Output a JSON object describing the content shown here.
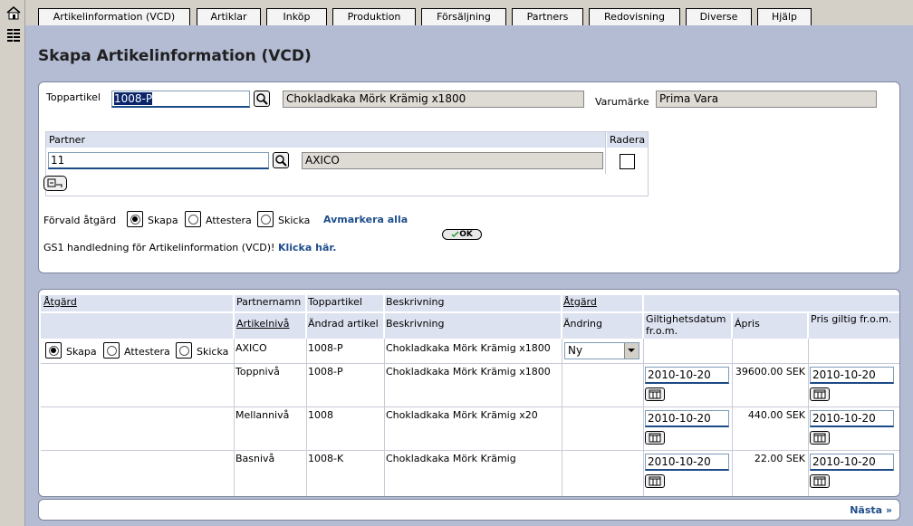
{
  "nav_tabs": [
    {
      "label": "Artikelinformation (VCD)"
    },
    {
      "label": "Artiklar"
    },
    {
      "label": "Inköp"
    },
    {
      "label": "Produktion"
    },
    {
      "label": "Försäljning"
    },
    {
      "label": "Partners"
    },
    {
      "label": "Redovisning"
    },
    {
      "label": "Diverse"
    },
    {
      "label": "Hjälp"
    }
  ],
  "page_title": "Skapa Artikelinformation (VCD)",
  "form": {
    "toppartikel_label": "Toppartikel",
    "toppartikel_value": "1008-P",
    "toppartikel_desc": "Chokladkaka Mörk Krämig x1800",
    "varumarke_label": "Varumärke",
    "varumarke_value": "Prima Vara",
    "partner_label": "Partner",
    "radera_label": "Radera",
    "partner_value": "11",
    "partner_name": "AXICO",
    "forvald_label": "Förvald åtgärd",
    "action_skapa": "Skapa",
    "action_attestera": "Attestera",
    "action_skicka": "Skicka",
    "avmarkera_label": "Avmarkera alla",
    "ok_label": "OK",
    "gs1_text": "GS1 handledning för Artikelinformation (VCD)!",
    "gs1_link": "Klicka här."
  },
  "table": {
    "h1": {
      "atgard": "Åtgärd",
      "partnernamn": "Partnernamn",
      "toppartikel": "Toppartikel",
      "beskrivning": "Beskrivning",
      "atgard2": "Åtgärd"
    },
    "h2": {
      "artikelniva": "Artikelnivå",
      "andrad_artikel": "Ändrad artikel",
      "beskrivning": "Beskrivning",
      "andring": "Ändring",
      "giltighet": "Giltighetsdatum fr.o.m.",
      "apris": "Ápris",
      "pris_giltig": "Pris giltig fr.o.m."
    },
    "partner_row": {
      "skapa": "Skapa",
      "attestera": "Attestera",
      "skicka": "Skicka",
      "partnernamn": "AXICO",
      "toppartikel": "1008-P",
      "beskrivning": "Chokladkaka Mörk Krämig x1800",
      "andring": "Ny"
    },
    "rows": [
      {
        "niva": "Toppnivå",
        "artikel": "1008-P",
        "beskrivning": "Chokladkaka Mörk Krämig x1800",
        "giltighet": "2010-10-20",
        "apris": "39600.00 SEK",
        "pris_giltig": "2010-10-20"
      },
      {
        "niva": "Mellannivå",
        "artikel": "1008",
        "beskrivning": "Chokladkaka Mörk Krämig x20",
        "giltighet": "2010-10-20",
        "apris": "440.00 SEK",
        "pris_giltig": "2010-10-20"
      },
      {
        "niva": "Basnivå",
        "artikel": "1008-K",
        "beskrivning": "Chokladkaka Mörk Krämig",
        "giltighet": "2010-10-20",
        "apris": "22.00 SEK",
        "pris_giltig": "2010-10-20"
      }
    ]
  },
  "footer": {
    "next_label": "Nästa »"
  }
}
